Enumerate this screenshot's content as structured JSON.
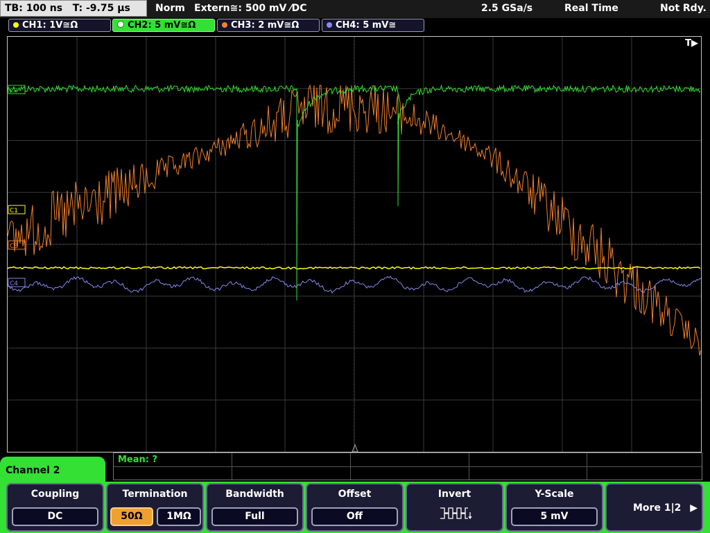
{
  "status": {
    "timebase": "TB: 100 ns",
    "trigger_time": "T: -9.75 µs",
    "mode": "Norm",
    "trigger_source": "Extern≅: 500 mV ⁄DC",
    "sample_rate": "2.5 GSa/s",
    "acq_mode": "Real Time",
    "state": "Not Rdy."
  },
  "channels": [
    {
      "label": "CH1: 1V≅Ω",
      "color": "#ffff00"
    },
    {
      "label": "CH2: 5 mV≅Ω",
      "color": "#33e033",
      "active": true
    },
    {
      "label": "CH3: 2 mV≅Ω",
      "color": "#f08030"
    },
    {
      "label": "CH4: 5 mV≅",
      "color": "#8888ee"
    }
  ],
  "screen": {
    "trigger_marker": "T▶",
    "markers": {
      "c1": "C1",
      "c2": "C2",
      "c3": "C3",
      "c4": "C4"
    },
    "colors": {
      "grid": "#3a3a3a",
      "ch1": "#ffff00",
      "ch2": "#33e033",
      "ch3": "#f08030",
      "ch4": "#8888ee"
    }
  },
  "measurement": {
    "label": "Mean: ?"
  },
  "menu": {
    "title": "Channel 2",
    "coupling": {
      "title": "Coupling",
      "value": "DC"
    },
    "termination": {
      "title": "Termination",
      "opt1": "50Ω",
      "opt2": "1MΩ",
      "selected": "50Ω"
    },
    "bandwidth": {
      "title": "Bandwidth",
      "value": "Full"
    },
    "offset": {
      "title": "Offset",
      "value": "Off"
    },
    "invert": {
      "title": "Invert",
      "icon": "invert-waveform-icon"
    },
    "yscale": {
      "title": "Y-Scale",
      "value": "5 mV"
    },
    "more": {
      "label": "More 1|2",
      "icon": "right-arrow-icon"
    }
  }
}
